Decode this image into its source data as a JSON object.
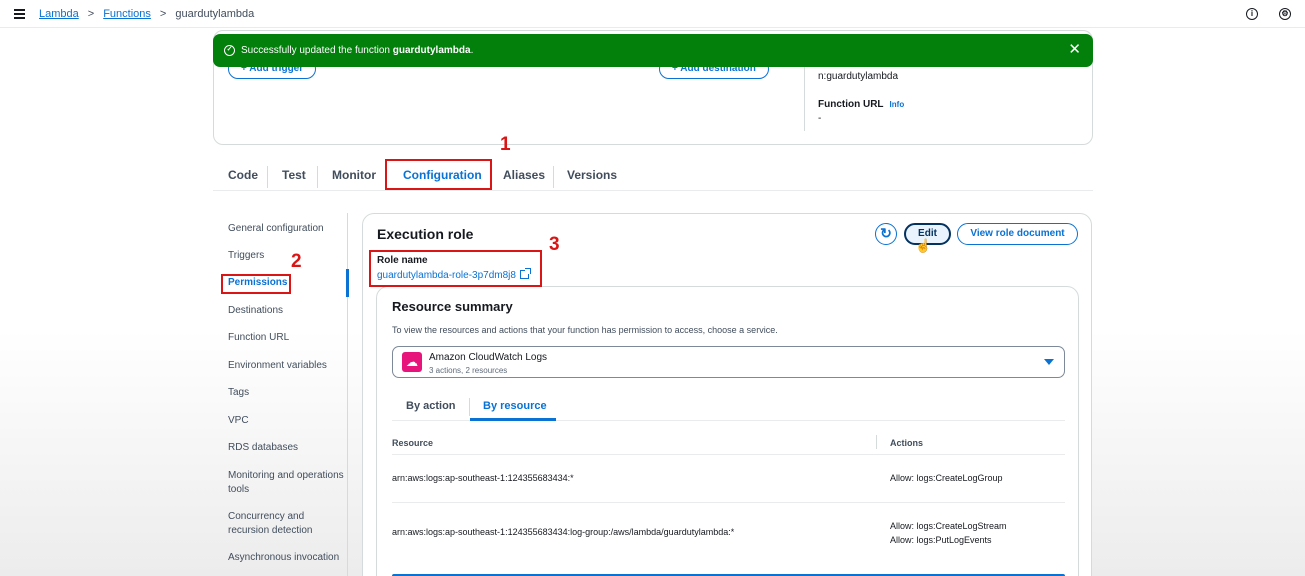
{
  "breadcrumbs": {
    "lambda": "Lambda",
    "functions": "Functions",
    "current": "guardutylambda",
    "separator": ">"
  },
  "top_icons": [
    "info-icon",
    "settings-icon"
  ],
  "overview": {
    "add_trigger": "+ Add trigger",
    "add_destination": "+ Add destination",
    "arn_tail": "n:guardutylambda",
    "function_url_label": "Function URL",
    "info_link": "Info",
    "function_url_value": "-"
  },
  "flash": {
    "prefix": "Successfully updated the function",
    "function_name": "guardutylambda",
    "suffix": ".",
    "color": "#037f0c"
  },
  "tabs": [
    {
      "label": "Code"
    },
    {
      "label": "Test"
    },
    {
      "label": "Monitor"
    },
    {
      "label": "Configuration",
      "active": true
    },
    {
      "label": "Aliases"
    },
    {
      "label": "Versions"
    }
  ],
  "annotations": {
    "one": "1",
    "two": "2",
    "three": "3",
    "color": "#d91515"
  },
  "sidenav": [
    {
      "label": "General configuration"
    },
    {
      "label": "Triggers"
    },
    {
      "label": "Permissions",
      "active": true
    },
    {
      "label": "Destinations"
    },
    {
      "label": "Function URL"
    },
    {
      "label": "Environment variables"
    },
    {
      "label": "Tags"
    },
    {
      "label": "VPC"
    },
    {
      "label": "RDS databases"
    },
    {
      "label": "Monitoring and operations tools"
    },
    {
      "label": "Concurrency and recursion detection"
    },
    {
      "label": "Asynchronous invocation"
    }
  ],
  "execution_role": {
    "title": "Execution role",
    "edit_label": "Edit",
    "view_role_label": "View role document",
    "role_name_label": "Role name",
    "role_name_value": "guardutylambda-role-3p7dm8j8"
  },
  "resource_summary": {
    "title": "Resource summary",
    "description": "To view the resources and actions that your function has permission to access, choose a service.",
    "service": {
      "name": "Amazon CloudWatch Logs",
      "meta": "3 actions, 2 resources",
      "icon": "cloudwatch-icon"
    },
    "subtabs": [
      {
        "label": "By action"
      },
      {
        "label": "By resource",
        "active": true
      }
    ],
    "columns": {
      "resource": "Resource",
      "actions": "Actions"
    },
    "rows": [
      {
        "resource": "arn:aws:logs:ap-southeast-1:124355683434:*",
        "actions": [
          "Allow: logs:CreateLogGroup"
        ]
      },
      {
        "resource": "arn:aws:logs:ap-southeast-1:124355683434:log-group:/aws/lambda/guardutylambda:*",
        "actions": [
          "Allow: logs:CreateLogStream",
          "Allow: logs:PutLogEvents"
        ]
      }
    ]
  },
  "colors": {
    "link": "#0972d3",
    "success": "#037f0c",
    "annotation": "#d91515"
  }
}
